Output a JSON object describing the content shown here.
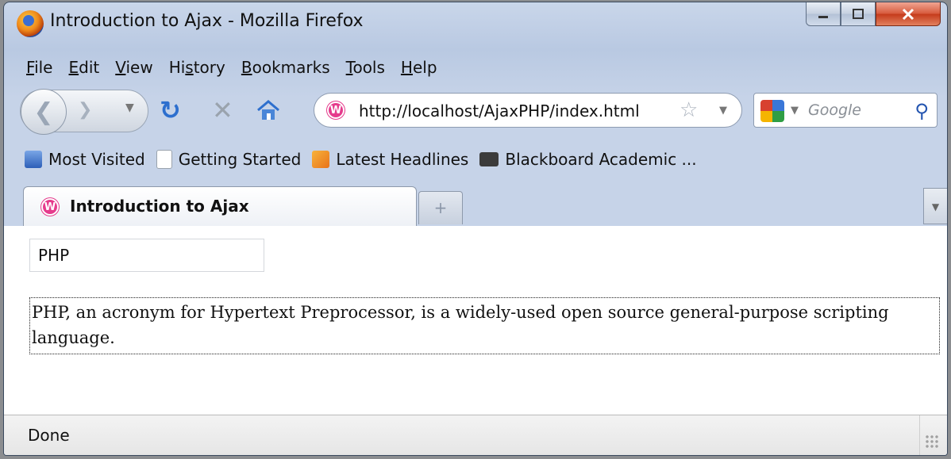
{
  "window": {
    "title": "Introduction to Ajax - Mozilla Firefox"
  },
  "menu": [
    "File",
    "Edit",
    "View",
    "History",
    "Bookmarks",
    "Tools",
    "Help"
  ],
  "menu_access_keys": [
    "F",
    "E",
    "V",
    "s",
    "B",
    "T",
    "H"
  ],
  "navigation": {
    "url": "http://localhost/AjaxPHP/index.html",
    "search_placeholder": "Google"
  },
  "bookmarks": [
    {
      "label": "Most Visited",
      "icon": "most-visited-icon"
    },
    {
      "label": "Getting Started",
      "icon": "page-icon"
    },
    {
      "label": "Latest Headlines",
      "icon": "rss-feed-icon"
    },
    {
      "label": "Blackboard Academic ...",
      "icon": "blackboard-icon"
    }
  ],
  "tabs": [
    {
      "label": "Introduction to Ajax",
      "active": true
    }
  ],
  "content": {
    "query_value": "PHP",
    "result_text": "PHP, an acronym for Hypertext Preprocessor, is a widely-used open source general-purpose scripting language."
  },
  "status": {
    "text": "Done"
  },
  "colors": {
    "accent": "#2d6fce",
    "favicon": "#e53b8c",
    "close_button": "#c4391a"
  }
}
